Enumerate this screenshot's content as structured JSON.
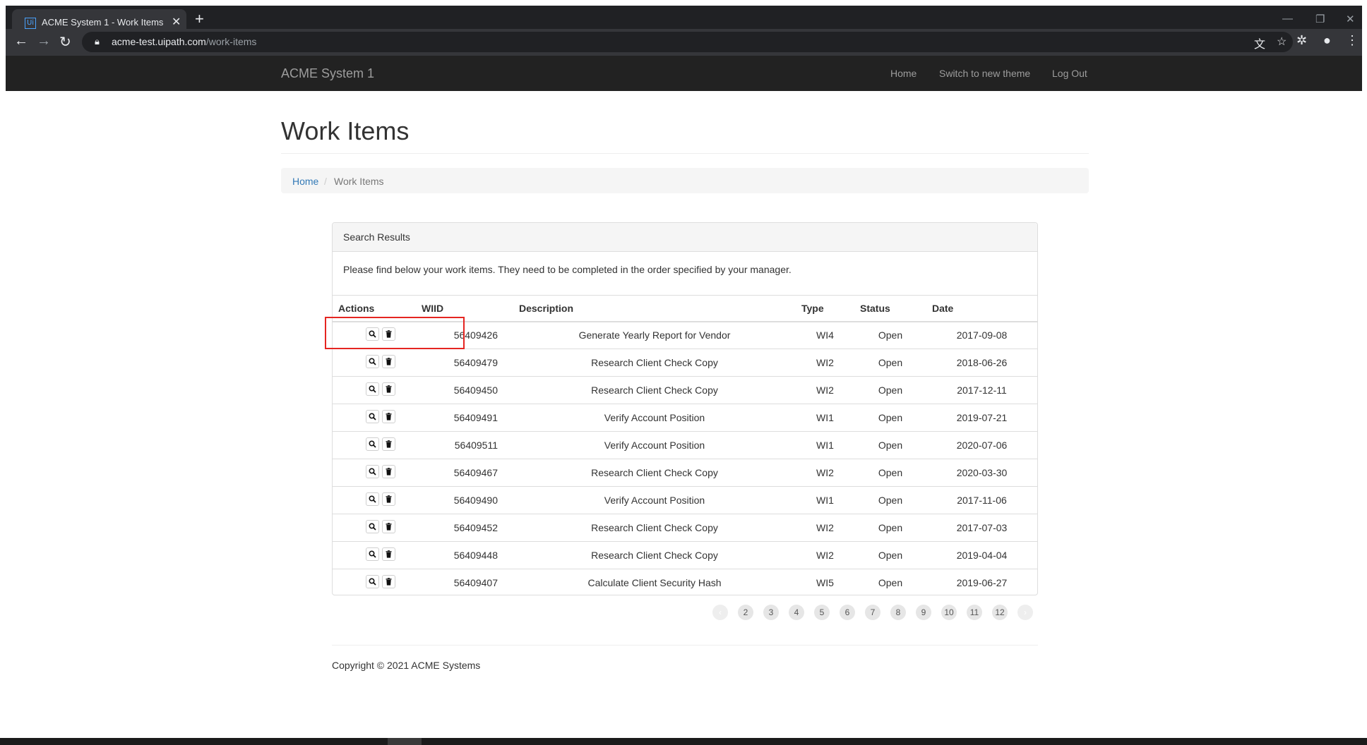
{
  "browser": {
    "tab_title": "ACME System 1 - Work Items",
    "favicon_text": "Ui",
    "url_host": "acme-test.uipath.com",
    "url_path": "/work-items"
  },
  "navbar": {
    "brand": "ACME System 1",
    "links": [
      "Home",
      "Switch to new theme",
      "Log Out"
    ]
  },
  "page": {
    "title": "Work Items",
    "breadcrumb": {
      "home": "Home",
      "separator": "/",
      "current": "Work Items"
    }
  },
  "panel": {
    "heading": "Search Results",
    "intro": "Please find below your work items. They need to be completed in the order specified by your manager."
  },
  "table": {
    "headers": [
      "Actions",
      "WIID",
      "Description",
      "Type",
      "Status",
      "Date"
    ],
    "rows": [
      {
        "wiid": "56409426",
        "description": "Generate Yearly Report for Vendor",
        "type": "WI4",
        "status": "Open",
        "date": "2017-09-08"
      },
      {
        "wiid": "56409479",
        "description": "Research Client Check Copy",
        "type": "WI2",
        "status": "Open",
        "date": "2018-06-26"
      },
      {
        "wiid": "56409450",
        "description": "Research Client Check Copy",
        "type": "WI2",
        "status": "Open",
        "date": "2017-12-11"
      },
      {
        "wiid": "56409491",
        "description": "Verify Account Position",
        "type": "WI1",
        "status": "Open",
        "date": "2019-07-21"
      },
      {
        "wiid": "56409511",
        "description": "Verify Account Position",
        "type": "WI1",
        "status": "Open",
        "date": "2020-07-06"
      },
      {
        "wiid": "56409467",
        "description": "Research Client Check Copy",
        "type": "WI2",
        "status": "Open",
        "date": "2020-03-30"
      },
      {
        "wiid": "56409490",
        "description": "Verify Account Position",
        "type": "WI1",
        "status": "Open",
        "date": "2017-11-06"
      },
      {
        "wiid": "56409452",
        "description": "Research Client Check Copy",
        "type": "WI2",
        "status": "Open",
        "date": "2017-07-03"
      },
      {
        "wiid": "56409448",
        "description": "Research Client Check Copy",
        "type": "WI2",
        "status": "Open",
        "date": "2019-04-04"
      },
      {
        "wiid": "56409407",
        "description": "Calculate Client Security Hash",
        "type": "WI5",
        "status": "Open",
        "date": "2019-06-27"
      }
    ]
  },
  "pagination": {
    "prev": "‹",
    "pages": [
      "1",
      "2",
      "3",
      "4",
      "5",
      "6",
      "7",
      "8",
      "9",
      "10",
      "11",
      "12"
    ],
    "next": "›",
    "current_page": "1"
  },
  "footer": {
    "copyright": "Copyright © 2021 ACME Systems"
  },
  "colors": {
    "navbar_bg": "#222222",
    "link": "#337ab7",
    "highlight_box": "#e52521"
  }
}
